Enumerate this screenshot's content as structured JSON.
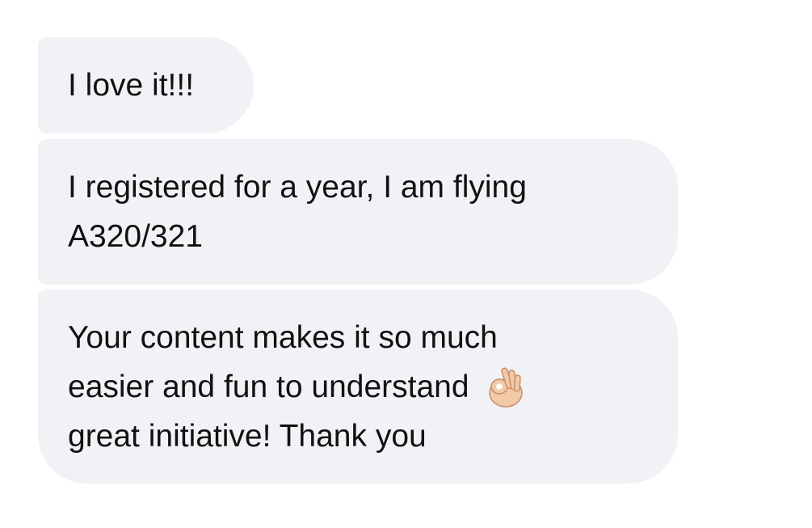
{
  "messages": [
    {
      "lines": [
        "I love it!!!"
      ]
    },
    {
      "lines": [
        "I registered for a year, I am flying",
        "A320/321"
      ]
    },
    {
      "lines": [
        "Your content makes it so much",
        "easier and fun to understand",
        "great initiative! Thank you"
      ]
    }
  ],
  "emoji": {
    "name": "ok-hand-emoji",
    "skin_color": "#f2c9a6"
  },
  "colors": {
    "bubble": "#f1f2f5",
    "text": "#111111",
    "background": "#ffffff"
  }
}
